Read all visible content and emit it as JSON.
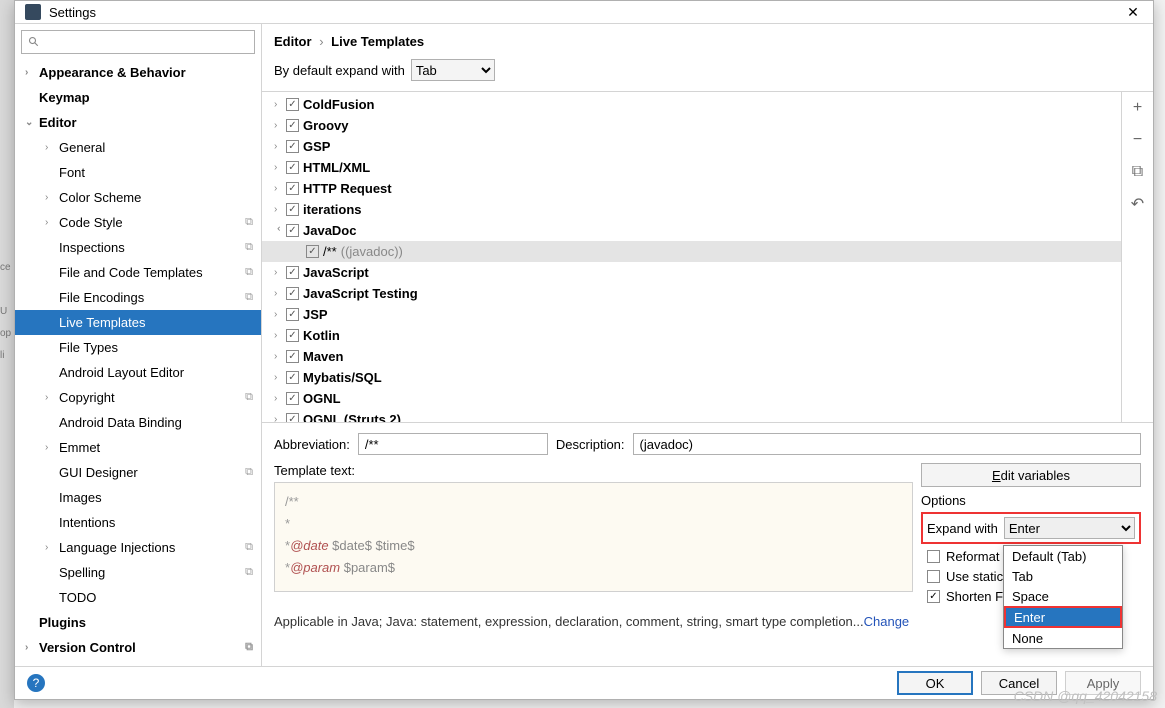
{
  "window": {
    "title": "Settings"
  },
  "search": {
    "placeholder": ""
  },
  "sidebar": {
    "items": [
      {
        "label": "Appearance & Behavior",
        "bold": true,
        "arrow": ">",
        "indent": 0
      },
      {
        "label": "Keymap",
        "bold": true,
        "indent": 0
      },
      {
        "label": "Editor",
        "bold": true,
        "arrow": "v",
        "indent": 0
      },
      {
        "label": "General",
        "arrow": ">",
        "indent": 1
      },
      {
        "label": "Font",
        "indent": 1
      },
      {
        "label": "Color Scheme",
        "arrow": ">",
        "indent": 1
      },
      {
        "label": "Code Style",
        "arrow": ">",
        "indent": 1,
        "copy": true
      },
      {
        "label": "Inspections",
        "indent": 1,
        "copy": true
      },
      {
        "label": "File and Code Templates",
        "indent": 1,
        "copy": true
      },
      {
        "label": "File Encodings",
        "indent": 1,
        "copy": true
      },
      {
        "label": "Live Templates",
        "indent": 1,
        "selected": true
      },
      {
        "label": "File Types",
        "indent": 1
      },
      {
        "label": "Android Layout Editor",
        "indent": 1
      },
      {
        "label": "Copyright",
        "arrow": ">",
        "indent": 1,
        "copy": true
      },
      {
        "label": "Android Data Binding",
        "indent": 1
      },
      {
        "label": "Emmet",
        "arrow": ">",
        "indent": 1
      },
      {
        "label": "GUI Designer",
        "indent": 1,
        "copy": true
      },
      {
        "label": "Images",
        "indent": 1
      },
      {
        "label": "Intentions",
        "indent": 1
      },
      {
        "label": "Language Injections",
        "arrow": ">",
        "indent": 1,
        "copy": true
      },
      {
        "label": "Spelling",
        "indent": 1,
        "copy": true
      },
      {
        "label": "TODO",
        "indent": 1
      },
      {
        "label": "Plugins",
        "bold": true,
        "indent": 0
      },
      {
        "label": "Version Control",
        "bold": true,
        "arrow": ">",
        "indent": 0,
        "copy": true
      }
    ]
  },
  "breadcrumb": {
    "a": "Editor",
    "b": "Live Templates"
  },
  "expand": {
    "label": "By default expand with",
    "value": "Tab"
  },
  "templates": [
    {
      "label": "ColdFusion",
      "checked": true
    },
    {
      "label": "Groovy",
      "checked": true
    },
    {
      "label": "GSP",
      "checked": true
    },
    {
      "label": "HTML/XML",
      "checked": true
    },
    {
      "label": "HTTP Request",
      "checked": true
    },
    {
      "label": "iterations",
      "checked": true
    },
    {
      "label": "JavaDoc",
      "checked": true,
      "expanded": true,
      "child": {
        "abbr": "/**",
        "desc": "((javadoc))"
      }
    },
    {
      "label": "JavaScript",
      "checked": true
    },
    {
      "label": "JavaScript Testing",
      "checked": true
    },
    {
      "label": "JSP",
      "checked": true
    },
    {
      "label": "Kotlin",
      "checked": true
    },
    {
      "label": "Maven",
      "checked": true
    },
    {
      "label": "Mybatis/SQL",
      "checked": true
    },
    {
      "label": "OGNL",
      "checked": true
    },
    {
      "label": "OGNL (Struts 2)",
      "checked": true
    }
  ],
  "toolbar": {
    "add": "+",
    "remove": "−",
    "copy": "⧉",
    "undo": "↶"
  },
  "form": {
    "abbr_label": "Abbreviation:",
    "abbr_value": "/**",
    "desc_label": "Description:",
    "desc_value": "(javadoc)",
    "templ_label": "Template text:",
    "editvar": "Edit variables"
  },
  "code": {
    "l1": "/**",
    "l2": " *",
    "l3a": " *",
    "l3b": "@date",
    "l3c": " $date$ $time$",
    "l4a": " *",
    "l4b": "@param",
    "l4c": " $param$"
  },
  "options": {
    "label": "Options",
    "expand_label": "Expand with",
    "expand_value": "Enter",
    "reformat": "Reformat",
    "static": "Use static",
    "shorten": "Shorten F"
  },
  "dropdown": {
    "items": [
      "Default (Tab)",
      "Tab",
      "Space",
      "Enter",
      "None"
    ],
    "selected": "Enter"
  },
  "applicable": {
    "text": "Applicable in Java; Java: statement, expression, declaration, comment, string, smart type completion...",
    "change": "Change"
  },
  "buttons": {
    "ok": "OK",
    "cancel": "Cancel",
    "apply": "Apply"
  },
  "watermark": "CSDN @qq_42042158"
}
